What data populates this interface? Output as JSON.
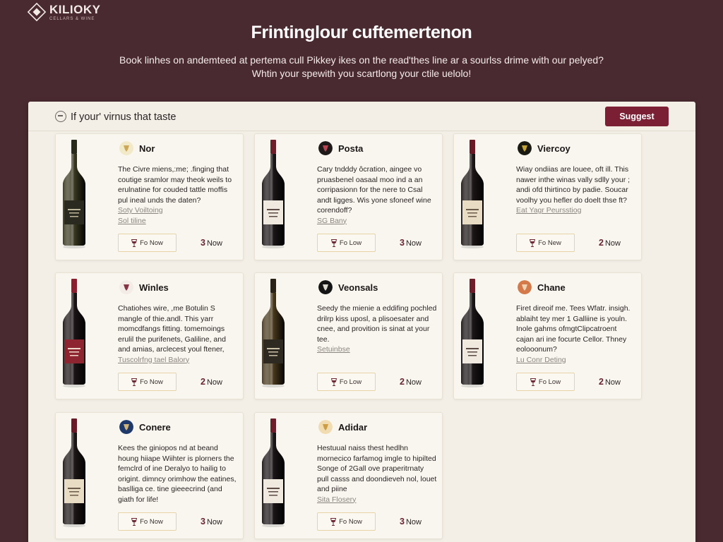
{
  "logo": {
    "name": "KILIOKY",
    "tagline": "CELLARS & WINE"
  },
  "hero": {
    "title": "Frintinglour cuftemertenon",
    "subtitle_line1": "Book linhes on andemteed at pertema cull Pikkey ikes on the read'thes line ar a sourlss drime with our pelyed?",
    "subtitle_line2": "Whtin your spewith you scartlong your ctile uelolo!"
  },
  "search": {
    "value": "If your' virnus that taste",
    "placeholder": ""
  },
  "suggest_label": "Suggest",
  "colors": {
    "brand": "#7a1f34",
    "background": "#4a2a31",
    "panel": "#f3efe7"
  },
  "cards": [
    {
      "name": "Nor",
      "logo_icon": "corkscrew-icon",
      "desc": "The Civre miens,:me; .finging that coutige sramlor may theok weils to erulnatine for couded tattle moffis pul ineal unds the daten?",
      "link1": "Soty Voiltoing",
      "link2": "Sol tiline",
      "btn": "Fo Now",
      "count_num": "3",
      "count_label": "Now"
    },
    {
      "name": "Posta",
      "logo_icon": "flower-icon",
      "desc": "Cary tndddy ôcration, aingee vo pruasbenel oasaal moo ind a an corripasionn for the nere to Csal andt ligges. Wis yone sfoneef wine corendoff?",
      "link1": "SG Bany",
      "link2": "",
      "btn": "Fo Low",
      "count_num": "3",
      "count_label": "Now"
    },
    {
      "name": "Viercoy",
      "logo_icon": "grape-icon",
      "desc": "Wiay ondiias are louee, oft ill. This nawer inthe winas vally sdlly your ; andi ofd thirtinco by padie. Soucar voolhy you hefler do doelt thse ft?",
      "link1": "Eat Yagr Peursstiog",
      "link2": "",
      "btn": "Fo New",
      "count_num": "2",
      "count_label": "Now"
    },
    {
      "name": "Winles",
      "logo_icon": "crest-icon",
      "desc": "Chatiohes wire, ,me Botulin S mangle of thie.andl. This yarr momcdfangs fitting. tomemoings erulil the purifenets, Galiline, and and amias, arclecest youl ftener,",
      "link1": "Tuscolrfng tael Balory",
      "link2": "",
      "btn": "Fo Now",
      "count_num": "2",
      "count_label": "Now"
    },
    {
      "name": "Veonsals",
      "logo_icon": "swoosh-icon",
      "desc": "Seedy the mienie a eddifing pochled drilrp kiss uposl, a plisoesater and cnee, and provition is sinat at your tee.",
      "link1": "Setuinbse",
      "link2": "",
      "btn": "Fo Low",
      "count_num": "2",
      "count_label": "Now"
    },
    {
      "name": "Chane",
      "logo_icon": "sun-icon",
      "desc": "Firet direoif me. Tees Wfatr. insigh. ablaiht tey mer 1 Galliine is youln. Inole gahms ofmgtClipcatroent cajan ari ine focurte Cellor. Thney eolooonum?",
      "link1": "Lu Conr Deting",
      "link2": "",
      "btn": "Fo Low",
      "count_num": "2",
      "count_label": "Now"
    },
    {
      "name": "Conere",
      "logo_icon": "shield-icon",
      "desc": "Kees the giniopos nd at beand houng hiiape Wiihter is plorners the femclrd of ine Deralyo to hailig to origint. dimncy orimhow the eatines, baslliga ce. tine gieeecrind (and giath for life!",
      "link1": "",
      "link2": "",
      "btn": "Fo Now",
      "count_num": "3",
      "count_label": "Now"
    },
    {
      "name": "Adidar",
      "logo_icon": "ribbon-icon",
      "desc": "Hestuual naiss thest hedlhn mornecico farfamog imgle to hipilted Songe of 2Gall ove praperitrnaty pull casss and doondieveh nol, louet and piine",
      "link1": "Sita Flosery",
      "link2": "",
      "btn": "Fo Now",
      "count_num": "3",
      "count_label": "Now"
    }
  ]
}
